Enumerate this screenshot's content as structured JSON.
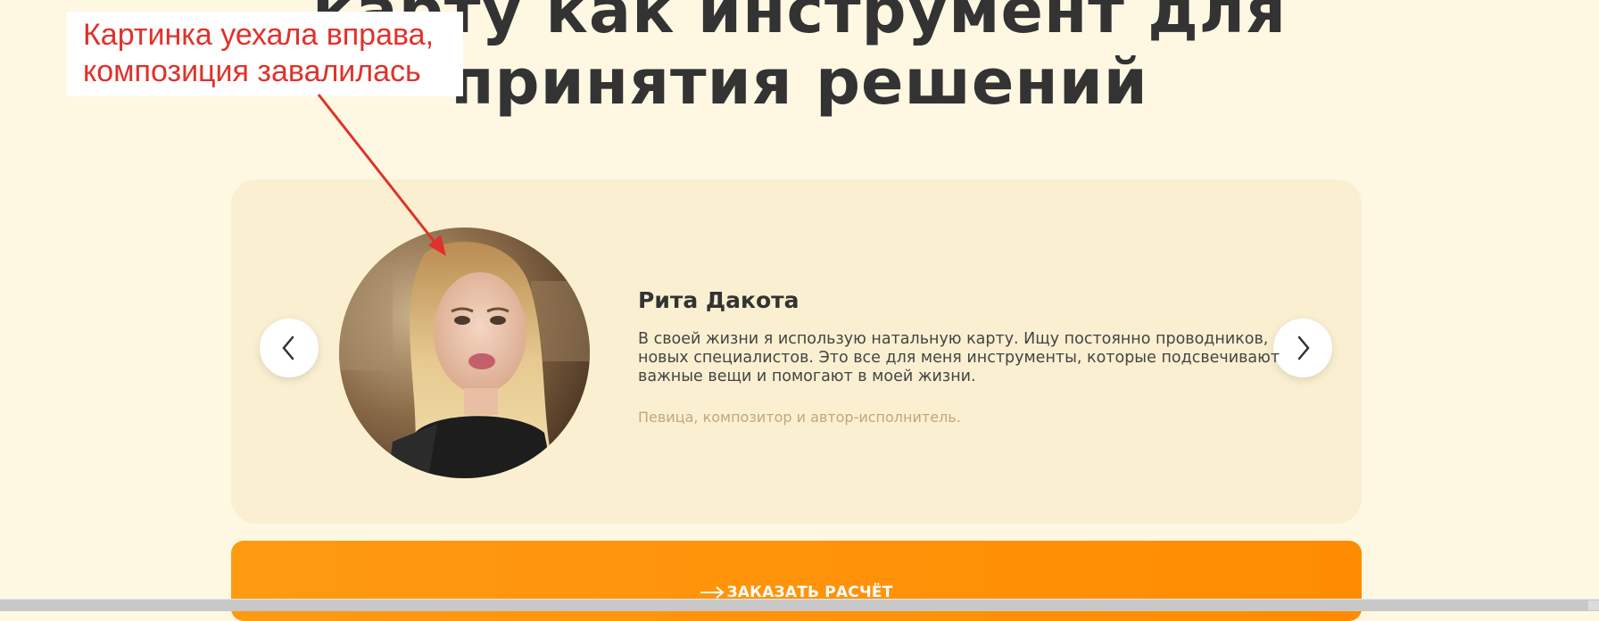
{
  "heading": {
    "line1": "карту как инструмент для",
    "line2": "принятия решений"
  },
  "annotation": {
    "line1": "Картинка уехала вправа,",
    "line2": "композиция завалилась",
    "color": "#e0322a"
  },
  "testimonial": {
    "name": "Рита Дакота",
    "quote": [
      "В своей жизни я использую натальную карту. Ищу постоянно проводников,",
      "новых специалистов. Это все для меня инструменты, которые подсвечивают",
      "важные вещи и помогают в моей жизни."
    ],
    "role": "Певица, композитор и автор-исполнитель."
  },
  "carousel": {
    "prev_icon": "chevron-left-icon",
    "next_icon": "chevron-right-icon"
  },
  "cta": {
    "label": "ЗАКАЗАТЬ РАСЧЁТ",
    "icon": "arrow-right-icon",
    "color": "#ff9a13"
  },
  "colors": {
    "page_bg": "#fef8e3",
    "card_bg": "#faf0d1",
    "heading": "#333333",
    "role": "#c2a77a"
  }
}
